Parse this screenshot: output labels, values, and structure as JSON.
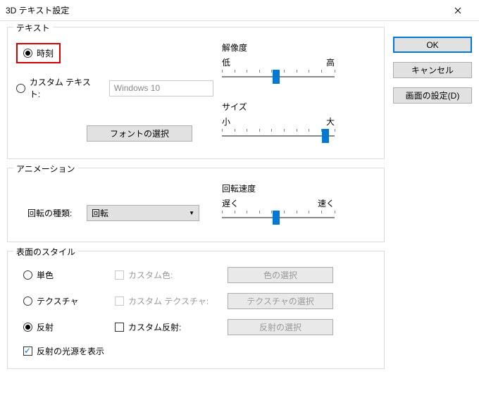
{
  "window": {
    "title": "3D テキスト設定"
  },
  "buttons": {
    "ok": "OK",
    "cancel": "キャンセル",
    "display_settings": "画面の設定(D)",
    "font_select": "フォントの選択",
    "color_select": "色の選択",
    "texture_select": "テクスチャの選択",
    "reflection_select": "反射の選択"
  },
  "groups": {
    "text": "テキスト",
    "animation": "アニメーション",
    "surface": "表面のスタイル"
  },
  "text": {
    "time": "時刻",
    "custom": "カスタム テキスト:",
    "custom_value": "Windows 10"
  },
  "sliders": {
    "resolution": {
      "label": "解像度",
      "min": "低",
      "max": "高",
      "pos": 48
    },
    "size": {
      "label": "サイズ",
      "min": "小",
      "max": "大",
      "pos": 92
    },
    "speed": {
      "label": "回転速度",
      "min": "遅く",
      "max": "速く",
      "pos": 48
    }
  },
  "animation": {
    "type_label": "回転の種類:",
    "type_value": "回転"
  },
  "surface": {
    "solid": "単色",
    "texture": "テクスチャ",
    "reflection": "反射",
    "custom_color": "カスタム色:",
    "custom_texture": "カスタム テクスチャ:",
    "custom_reflection": "カスタム反射:",
    "show_source": "反射の光源を表示"
  }
}
